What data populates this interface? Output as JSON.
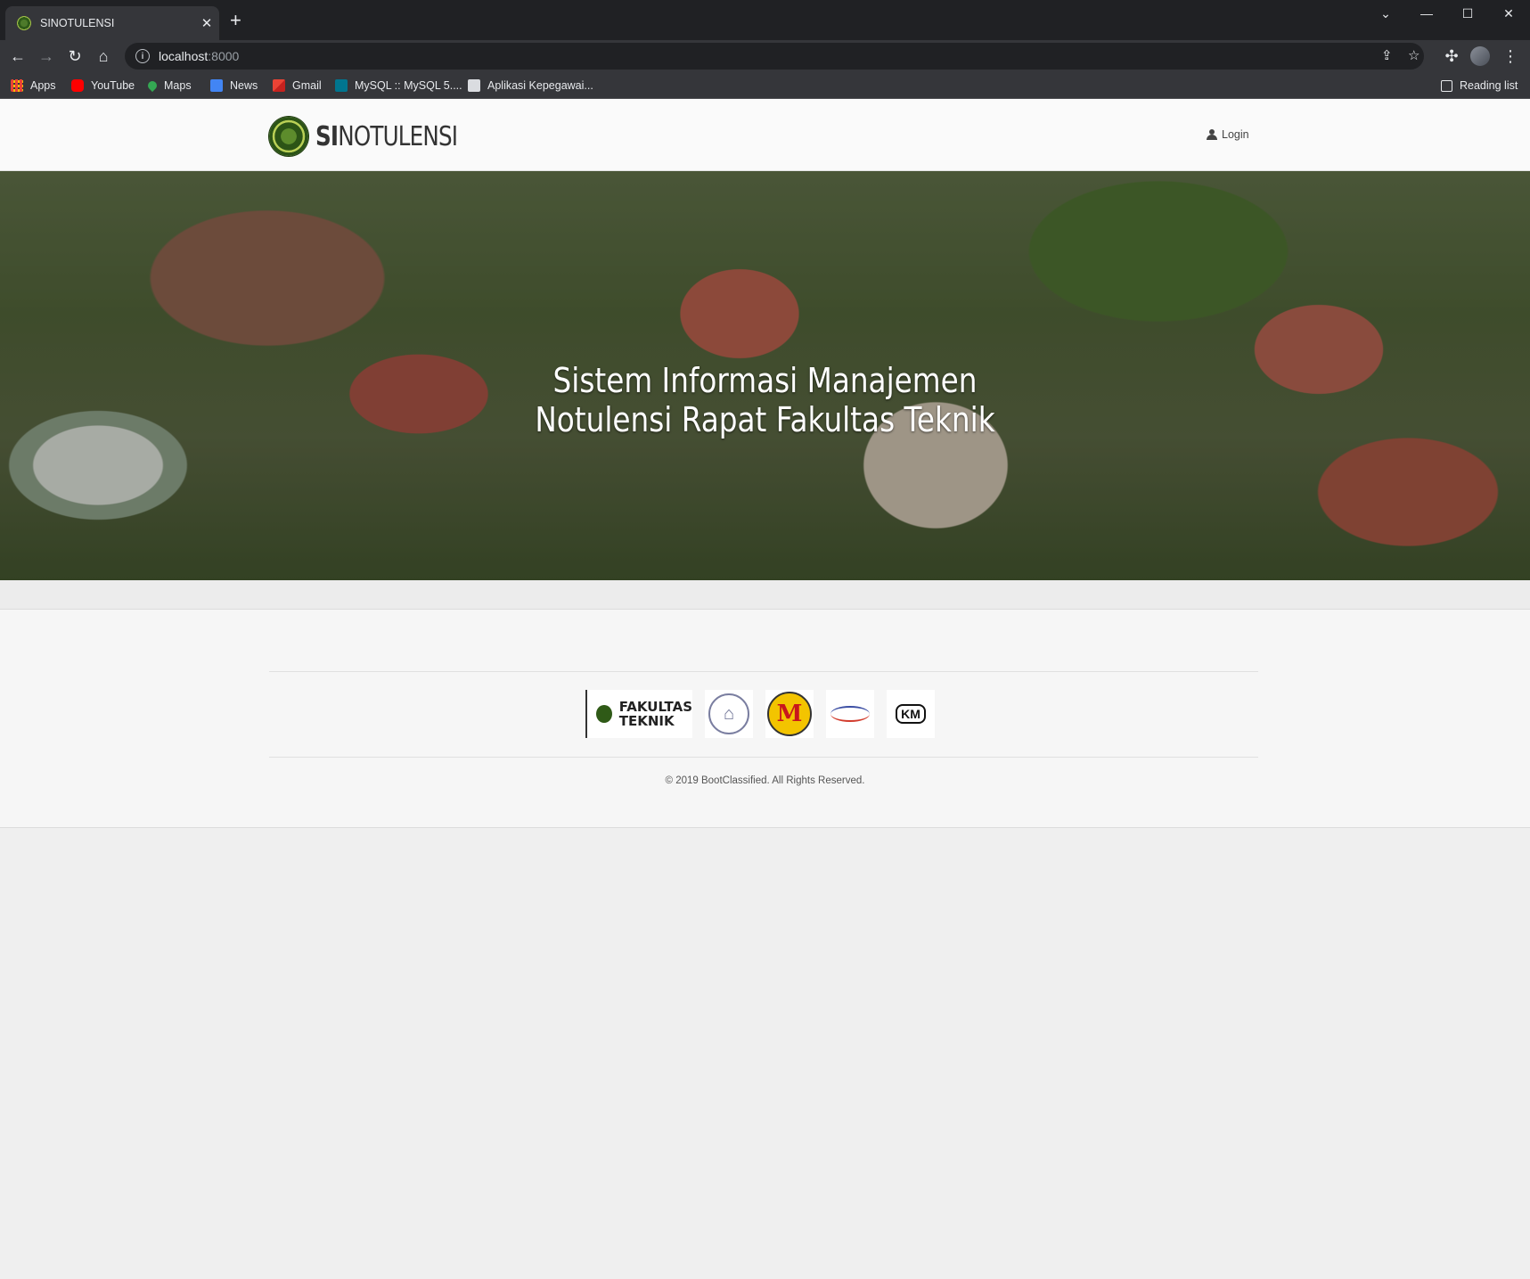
{
  "browser": {
    "tab_title": "SINOTULENSI",
    "tab_close": "✕",
    "new_tab": "+",
    "url_host": "localhost",
    "url_port": ":8000",
    "bookmarks": [
      "Apps",
      "YouTube",
      "Maps",
      "News",
      "Gmail",
      "MySQL :: MySQL 5....",
      "Aplikasi Kepegawai..."
    ],
    "reading_list": "Reading list"
  },
  "nav": {
    "brand_bold": "SI",
    "brand_rest": "NOTULENSI",
    "login": "Login"
  },
  "hero": {
    "line1": "Sistem Informasi Manajemen",
    "line2": "Notulensi Rapat Fakultas Teknik"
  },
  "footer": {
    "partner_logos": [
      {
        "name": "fakultas-teknik-logo",
        "text_line1": "FAKULTAS",
        "text_line2": "TEKNIK"
      },
      {
        "name": "seal-logo"
      },
      {
        "name": "m-logo",
        "text": "M"
      },
      {
        "name": "hmte-logo"
      },
      {
        "name": "km-logo",
        "text": "KM"
      }
    ],
    "copyright": "© 2019 BootClassified. All Rights Reserved."
  }
}
